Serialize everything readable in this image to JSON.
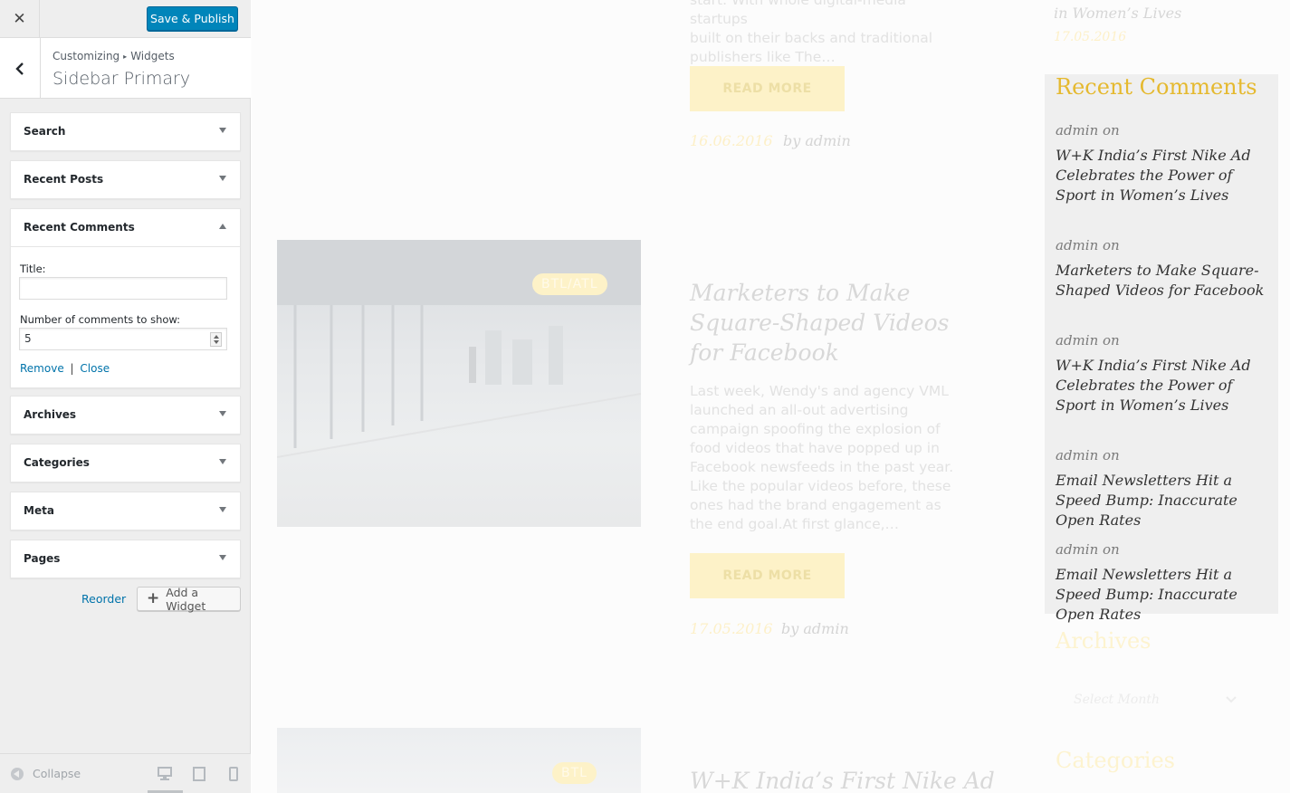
{
  "customizer": {
    "close_icon": "close-icon",
    "save_label": "Save & Publish",
    "breadcrumb_root": "Customizing",
    "breadcrumb_child": "Widgets",
    "section_title": "Sidebar Primary",
    "widgets": [
      {
        "title": "Search",
        "expanded": false
      },
      {
        "title": "Recent Posts",
        "expanded": false
      },
      {
        "title": "Recent Comments",
        "expanded": true
      },
      {
        "title": "Archives",
        "expanded": false
      },
      {
        "title": "Categories",
        "expanded": false
      },
      {
        "title": "Meta",
        "expanded": false
      },
      {
        "title": "Pages",
        "expanded": false
      }
    ],
    "recent_comments_form": {
      "title_label": "Title:",
      "title_value": "",
      "number_label": "Number of comments to show:",
      "number_value": "5",
      "remove_label": "Remove",
      "separator": "|",
      "close_label": "Close"
    },
    "reorder_label": "Reorder",
    "add_widget_label": "Add a Widget",
    "collapse_label": "Collapse"
  },
  "preview": {
    "post1": {
      "excerpt_line1": "start. With whole digital-media startups",
      "excerpt_line2": "built on their backs and traditional",
      "excerpt_line3": "publishers like The…",
      "read_more": "READ MORE",
      "date": "16.06.2016",
      "author": "by admin"
    },
    "post2": {
      "badge": "BTL/ATL",
      "title": "Marketers to Make Square-Shaped Videos for Facebook",
      "excerpt": "Last week, Wendy's and agency VML launched an all-out advertising campaign spoofing the explosion of food videos that have popped up in Facebook newsfeeds in the past year. Like the popular videos before, these ones had the brand engagement as the end goal.At first glance,…",
      "read_more": "READ MORE",
      "date": "17.05.2016",
      "author": "by admin"
    },
    "post3": {
      "badge": "BTL",
      "title": "W+K India’s First Nike Ad"
    },
    "sidebar_top": {
      "link_tail": "in Women’s Lives",
      "date": "17.05.2016"
    },
    "recent_comments": {
      "title": "Recent Comments",
      "items": [
        {
          "meta": "admin on",
          "link": "W+K India’s First Nike Ad Celebrates the Power of Sport in Women’s Lives"
        },
        {
          "meta": "admin on",
          "link": "Marketers to Make Square-Shaped Videos for Facebook"
        },
        {
          "meta": "admin on",
          "link": "W+K India’s First Nike Ad Celebrates the Power of Sport in Women’s Lives"
        },
        {
          "meta": "admin on",
          "link": "Email Newsletters Hit a Speed Bump: Inaccurate Open Rates"
        },
        {
          "meta": "admin on",
          "link": "Email Newsletters Hit a Speed Bump: Inaccurate Open Rates"
        }
      ]
    },
    "archives_title": "Archives",
    "archives_select": "Select Month",
    "categories_title": "Categories"
  },
  "colors": {
    "primary_button": "#0085ba",
    "link": "#0073aa",
    "accent_gold": "#e5b92f"
  }
}
